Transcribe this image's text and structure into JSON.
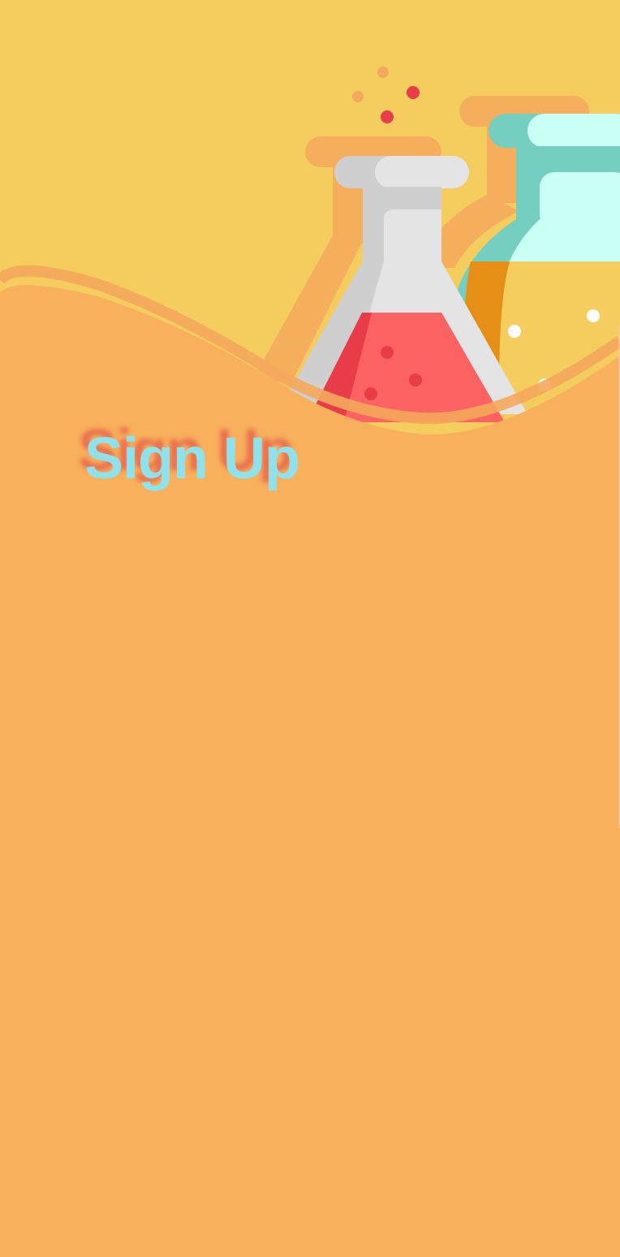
{
  "screen": {
    "title": "Sign Up",
    "illustration_icon": "chemistry-flask-icon"
  },
  "colors": {
    "background": "#f8b05c",
    "sky": "#f4cd5e",
    "title_text": "#8fe2ec",
    "flask_liquid": "#fd6262",
    "flask_glass": "#e4e4e4",
    "bottle_teal": "#75cfc0",
    "bottle_mint": "#c9fff4"
  }
}
